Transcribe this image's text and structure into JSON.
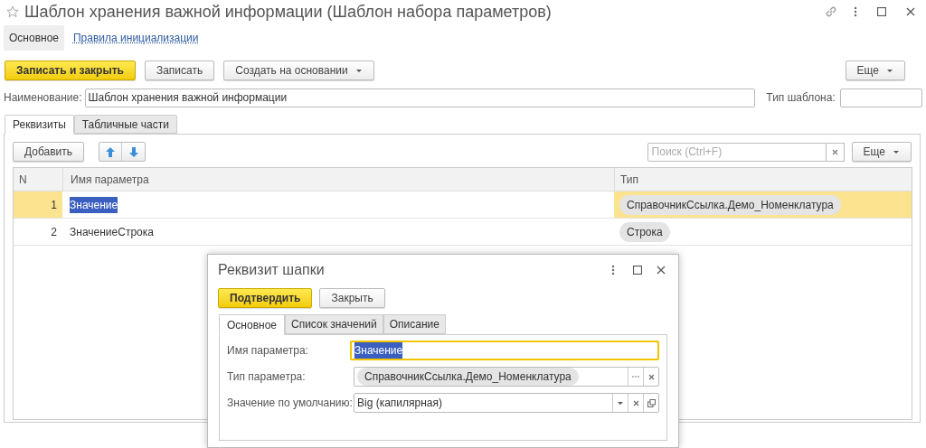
{
  "window": {
    "title": "Шаблон хранения важной информации (Шаблон набора параметров)"
  },
  "nav": [
    {
      "label": "Основное",
      "selected": true
    },
    {
      "label": "Правила инициализации",
      "selected": false
    }
  ],
  "toolbar": [
    {
      "label": "Записать и закрыть",
      "kind": "primary"
    },
    {
      "label": "Записать",
      "kind": "default"
    },
    {
      "label": "Создать на основании",
      "kind": "menu"
    }
  ],
  "more_button": "Еще",
  "name_field": {
    "label": "Наименование:",
    "value": "Шаблон хранения важной информации"
  },
  "template_type_field": {
    "label": "Тип шаблона:"
  },
  "tabs": [
    {
      "label": "Реквизиты",
      "selected": true
    },
    {
      "label": "Табличные части",
      "selected": false
    }
  ],
  "table_toolbar": {
    "add_button": "Добавить",
    "search_placeholder": "Поиск (Ctrl+F)",
    "more_button": "Еще"
  },
  "table": {
    "columns": [
      "N",
      "Имя параметра",
      "Тип"
    ],
    "rows": [
      {
        "n": "1",
        "name": "Значение",
        "type": "СправочникСсылка.Демо_Номенклатура",
        "selected": true
      },
      {
        "n": "2",
        "name": "ЗначениеСтрока",
        "type": "Строка",
        "selected": false
      }
    ]
  },
  "dialog": {
    "title": "Реквизит шапки",
    "buttons": [
      {
        "label": "Подтвердить",
        "kind": "primary"
      },
      {
        "label": "Закрыть",
        "kind": "default"
      }
    ],
    "tabs": [
      {
        "label": "Основное",
        "selected": true
      },
      {
        "label": "Список значений",
        "selected": false
      },
      {
        "label": "Описание",
        "selected": false
      }
    ],
    "fields": [
      {
        "label": "Имя параметра:",
        "value": "Значение",
        "kind": "text",
        "focused": true
      },
      {
        "label": "Тип параметра:",
        "value": "СправочникСсылка.Демо_Номенклатура",
        "kind": "chip",
        "focused": false
      },
      {
        "label": "Значение по умолчанию:",
        "value": "Big (капилярная)",
        "kind": "select",
        "focused": false
      }
    ]
  }
}
